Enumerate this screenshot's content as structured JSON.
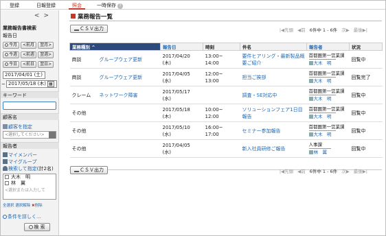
{
  "tabs": [
    "登録",
    "日報登録",
    "照会",
    "一時保存"
  ],
  "help_glyph": "?",
  "sidebar": {
    "nav_prev": "<",
    "nav_next": ">",
    "title": "業務報告書検索",
    "date_label": "報告日",
    "rows": [
      {
        "a": "今月",
        "b": "前月",
        "c": "翌月"
      },
      {
        "a": "今週",
        "b": "前週",
        "c": "翌週"
      },
      {
        "a": "今日",
        "b": "前日",
        "c": "翌日"
      }
    ],
    "date_from": "2017/04/01 (土)",
    "date_tilde": "~",
    "date_to": "2017/05/18 (木)",
    "cal_glyph": "▦",
    "keyword_label": "キーワード",
    "client_label": "顧客名",
    "client_link": "顧客を指定",
    "client_placeholder": "<選択してください>",
    "reporter_label": "報告者",
    "my_member": "マイメンバー",
    "my_group": "マイグループ",
    "search_specify": "検索して指定",
    "count_text": "(計2名)",
    "members": [
      "大木　明",
      "林　翼"
    ],
    "member_placeholder": "<選択または入力して",
    "select_all": "全選択",
    "clear_select": "選択解除",
    "delete": "削除",
    "detail_link": "条件を詳しく...",
    "search_button": "検 索"
  },
  "main": {
    "title": "業務報告一覧",
    "csv": "ＣＳＶ出力",
    "pager": {
      "first": "先頭",
      "prev": "前",
      "count": "6件中 1 - 6件",
      "next": "次",
      "last": "最後"
    },
    "columns": [
      "業務種別",
      "報告日",
      "時刻",
      "件名",
      "報告者",
      "状況"
    ],
    "sort_mark": "^",
    "rows": [
      {
        "type": "商談",
        "client": "グループウェア更新",
        "date": "2017/04/20",
        "day": "(木)",
        "t1": "13:00~",
        "t2": "14:00",
        "s1": "要件ヒアリング・最新製品概",
        "s2": "要ご紹介",
        "dept": "首都圏第一営業課",
        "person": "大木　明",
        "status": "回覧中"
      },
      {
        "type": "商談",
        "client": "グループウェア更新",
        "date": "2017/04/05",
        "day": "(水)",
        "t1": "12:00~",
        "t2": "13:00",
        "s1": "担当ご挨拶",
        "s2": "",
        "dept": "首都圏第一営業課",
        "person": "大木　明",
        "status": "回覧完了"
      },
      {
        "type": "クレーム",
        "client": "ネットワーク障害",
        "date": "2017/05/17",
        "day": "(水)",
        "t1": "",
        "t2": "",
        "s1": "調査・SE対応中",
        "s2": "",
        "dept": "首都圏第一営業課",
        "person": "大木　明",
        "status": "回覧中"
      },
      {
        "type": "その他",
        "client": "",
        "date": "2017/05/18",
        "day": "(木)",
        "t1": "10:00~",
        "t2": "12:00",
        "s1": "ソリューションフェア1日目報告",
        "s2": "",
        "dept": "首都圏第一営業課",
        "person": "大木　明",
        "status": "回覧中"
      },
      {
        "type": "その他",
        "client": "",
        "date": "2017/05/10",
        "day": "(水)",
        "t1": "16:00~",
        "t2": "17:00",
        "s1": "セミナー参加報告",
        "s2": "",
        "dept": "首都圏第一営業課",
        "person": "大木　明",
        "status": "回覧中"
      },
      {
        "type": "その他",
        "client": "",
        "date": "2017/04/05",
        "day": "(水)",
        "t1": "",
        "t2": "",
        "s1": "新入社員研修ご報告",
        "s2": "",
        "dept": "人事課",
        "person": "林　翼",
        "status": "回覧中"
      }
    ]
  },
  "colors": {
    "accent": "#c0392b",
    "header_sorted": "#2e4a7d",
    "link": "#1f67b1"
  }
}
